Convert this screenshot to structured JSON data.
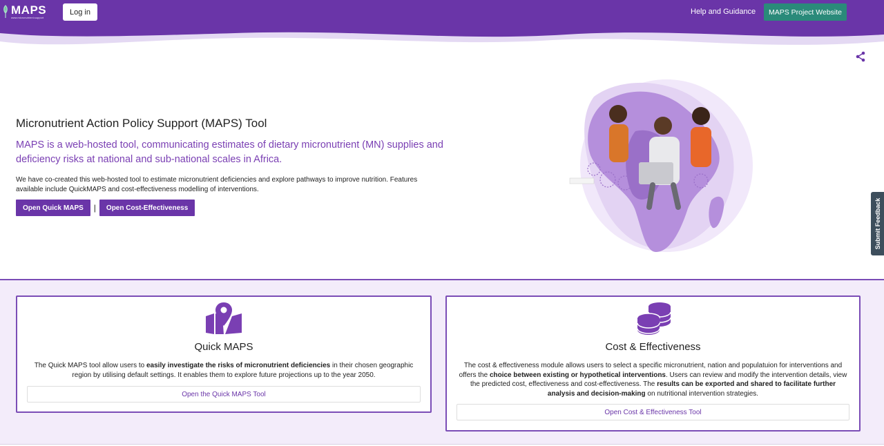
{
  "header": {
    "logo_text": "MAPS",
    "logo_sub": "www.micronutrient.support",
    "login_label": "Log in",
    "help_label": "Help and Guidance",
    "project_label": "MAPS Project Website"
  },
  "hero": {
    "title": "Micronutrient Action Policy Support (MAPS) Tool",
    "lead": "MAPS is a web-hosted tool, communicating estimates of dietary micronutrient (MN) supplies and deficiency risks at national and sub-national scales in Africa.",
    "body": "We have co-created this web-hosted tool to estimate micronutrient deficiencies and explore pathways to improve nutrition. Features available include QuickMAPS and cost-effectiveness modelling of interventions.",
    "btn_quick": "Open Quick MAPS",
    "separator": "|",
    "btn_cost": "Open Cost-Effectiveness"
  },
  "feedback_label": "Submit Feedback",
  "cards": {
    "quick": {
      "title": "Quick MAPS",
      "text_1": "The Quick MAPS tool allow users to ",
      "text_bold_1": "easily investigate the risks of micronutrient deficiencies",
      "text_2": " in their chosen geographic region by utilising default settings. It enables them to explore future projections up to the year 2050.",
      "link": "Open the Quick MAPS Tool"
    },
    "cost": {
      "title": "Cost & Effectiveness",
      "text_1": "The cost & effectiveness module allows users to select a specific micronutrient, nation and populatuion for interventions and offers the ",
      "text_bold_1": "choice between existing or hypothetical interventions",
      "text_2": ". Users can review and modify the intervention details, view the predicted cost, effectiveness and cost-effectiveness. The ",
      "text_bold_2": "results can be exported and shared to facilitate further analysis and decision-making",
      "text_3": " on nutritional intervention strategies.",
      "link": "Open Cost & Effectiveness Tool"
    }
  },
  "colors": {
    "brand_purple": "#6a35a8",
    "teal": "#2a8a7a",
    "lavender_bg": "#f3ecfa"
  },
  "icons": [
    "share-icon",
    "map-marker-icon",
    "coins-stack-icon"
  ]
}
